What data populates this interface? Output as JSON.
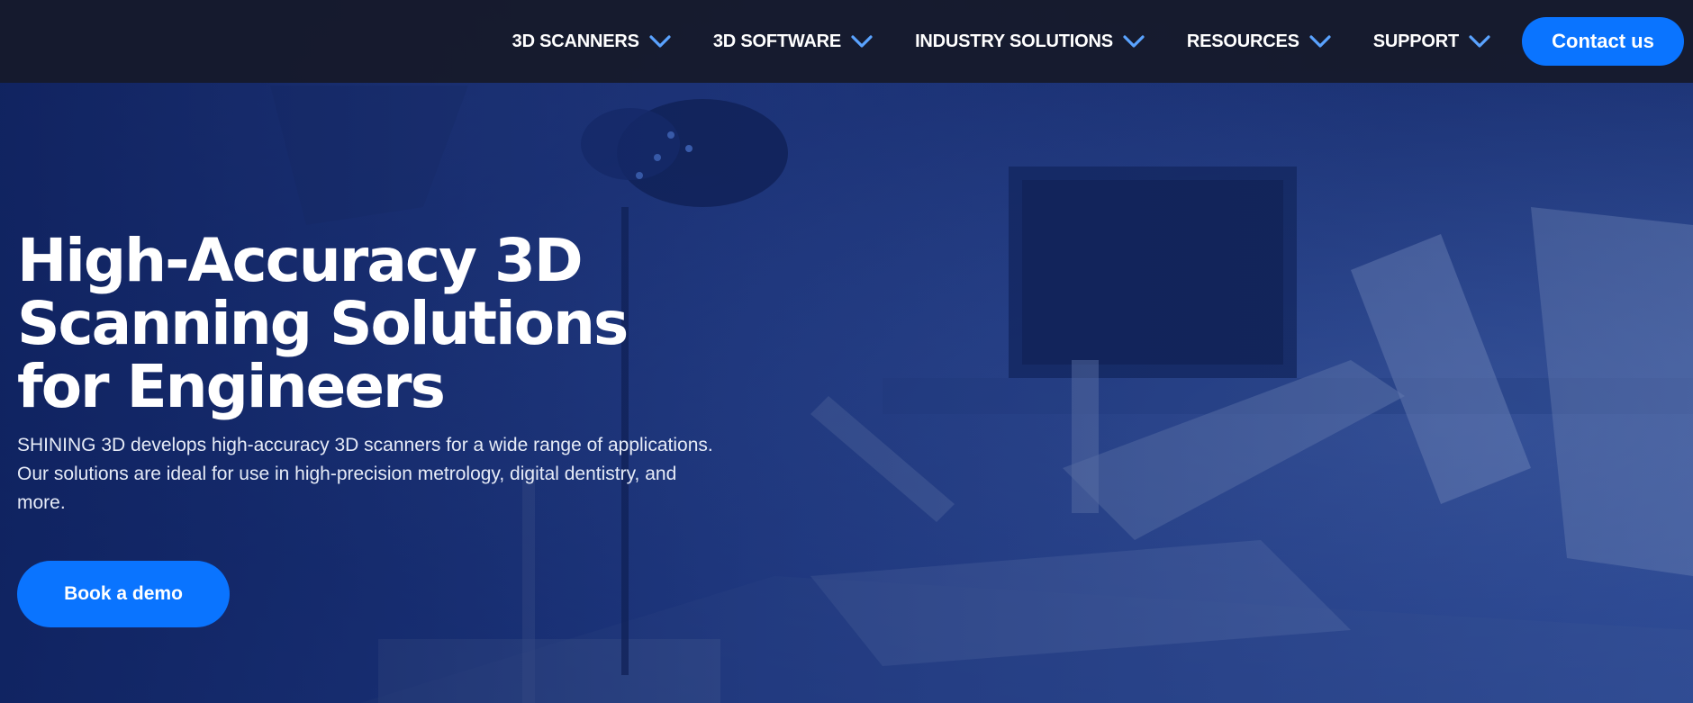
{
  "nav": {
    "items": [
      {
        "label": "3D SCANNERS",
        "icon": "chevron-down-icon"
      },
      {
        "label": "3D SOFTWARE",
        "icon": "chevron-down-icon"
      },
      {
        "label": "INDUSTRY SOLUTIONS",
        "icon": "chevron-down-icon"
      },
      {
        "label": "RESOURCES",
        "icon": "chevron-down-icon"
      },
      {
        "label": "SUPPORT",
        "icon": "chevron-down-icon"
      }
    ],
    "contact_label": "Contact us"
  },
  "hero": {
    "title_lines": [
      "High-Accuracy 3D",
      "Scanning Solutions",
      "for Engineers"
    ],
    "description": "SHINING 3D develops high-accuracy 3D scanners for a wide range of applications. Our solutions are ideal for use in high-precision metrology, digital dentistry, and more.",
    "cta_label": "Book a demo"
  },
  "colors": {
    "accent": "#0a74ff",
    "nav_bg": "#161a2c",
    "chevron": "#5aa3ff",
    "hero_overlay": "#0c1e5a"
  }
}
